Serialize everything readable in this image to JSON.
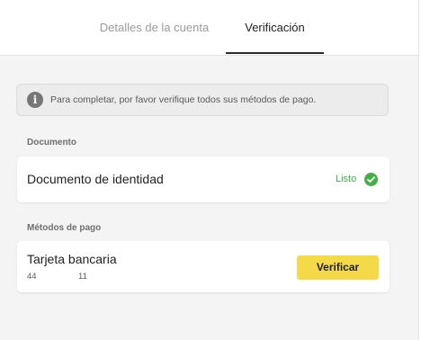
{
  "tabs": {
    "details_label": "Detalles de la cuenta",
    "verification_label": "Verificación",
    "active": "verification"
  },
  "notice": {
    "icon": "info-icon",
    "text": "Para completar, por favor verifique todos sus métodos de pago."
  },
  "document_section": {
    "label": "Documento",
    "item": {
      "title": "Documento de identidad",
      "status": "Listo",
      "status_icon": "check-circle-icon",
      "status_color": "#44b049"
    }
  },
  "payment_section": {
    "label": "Métodos de pago",
    "item": {
      "title": "Tarjeta bancaria",
      "number_start": "44",
      "number_end": "11",
      "button_label": "Verificar",
      "button_color": "#f6d948"
    }
  }
}
